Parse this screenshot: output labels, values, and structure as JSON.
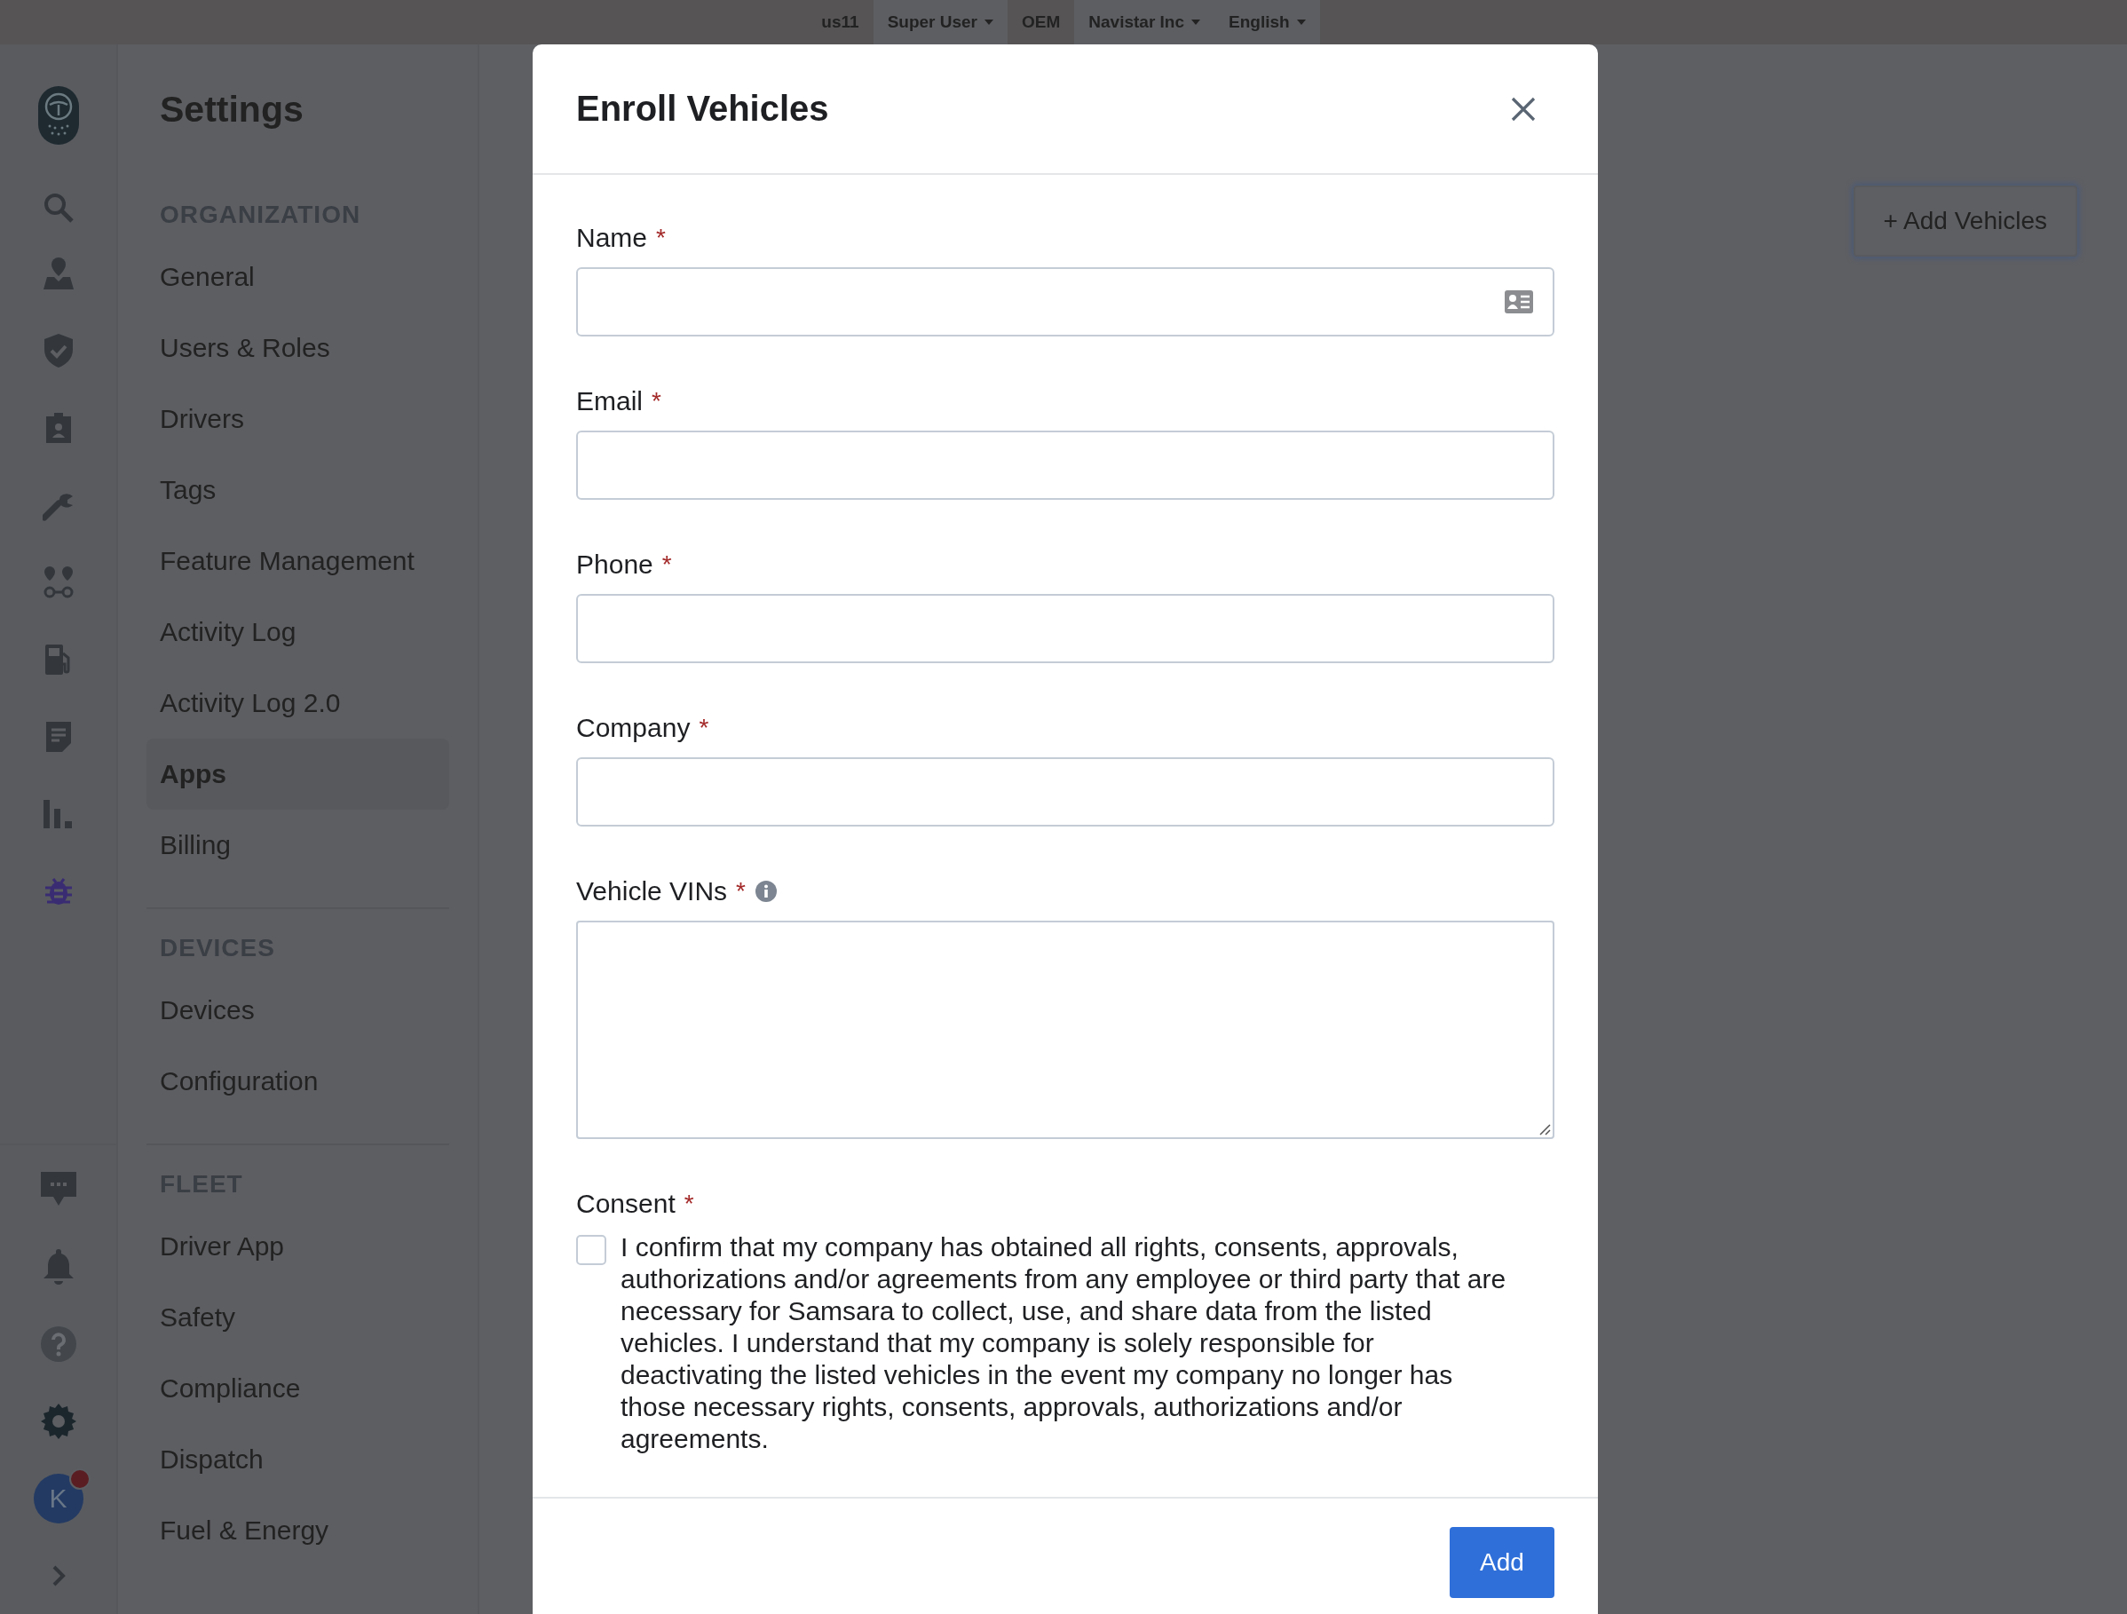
{
  "top_bar": {
    "items": [
      {
        "label": "us11",
        "kind": "plain"
      },
      {
        "label": "Super User",
        "kind": "dropdown"
      },
      {
        "label": "OEM",
        "kind": "plain"
      },
      {
        "label": "Navistar Inc",
        "kind": "dropdown"
      },
      {
        "label": "English",
        "kind": "dropdown"
      }
    ]
  },
  "icon_rail": {
    "avatar": {
      "initial": "K",
      "notification": true
    }
  },
  "settings_sidebar": {
    "title": "Settings",
    "sections": [
      {
        "heading": "ORGANIZATION",
        "items": [
          {
            "label": "General",
            "selected": false
          },
          {
            "label": "Users & Roles",
            "selected": false
          },
          {
            "label": "Drivers",
            "selected": false
          },
          {
            "label": "Tags",
            "selected": false
          },
          {
            "label": "Feature Management",
            "selected": false
          },
          {
            "label": "Activity Log",
            "selected": false
          },
          {
            "label": "Activity Log 2.0",
            "selected": false
          },
          {
            "label": "Apps",
            "selected": true
          },
          {
            "label": "Billing",
            "selected": false
          }
        ]
      },
      {
        "heading": "DEVICES",
        "items": [
          {
            "label": "Devices",
            "selected": false
          },
          {
            "label": "Configuration",
            "selected": false
          }
        ]
      },
      {
        "heading": "FLEET",
        "items": [
          {
            "label": "Driver App",
            "selected": false
          },
          {
            "label": "Safety",
            "selected": false
          },
          {
            "label": "Compliance",
            "selected": false
          },
          {
            "label": "Dispatch",
            "selected": false
          },
          {
            "label": "Fuel & Energy",
            "selected": false
          }
        ]
      }
    ]
  },
  "page": {
    "add_button": "+ Add Vehicles"
  },
  "modal": {
    "title": "Enroll Vehicles",
    "fields": [
      {
        "label": "Name",
        "required_mark": "*",
        "kind": "contact_input"
      },
      {
        "label": "Email",
        "required_mark": "*",
        "kind": "input"
      },
      {
        "label": "Phone",
        "required_mark": "*",
        "kind": "input"
      },
      {
        "label": "Company",
        "required_mark": "*",
        "kind": "input"
      },
      {
        "label": "Vehicle VINs",
        "required_mark": "*",
        "kind": "textarea",
        "info": true
      }
    ],
    "consent": {
      "label": "Consent",
      "required_mark": "*",
      "checked": false,
      "text": "I confirm that my company has obtained all rights, consents, approvals, authorizations and/or agreements from any employee or third party that are necessary for Samsara to collect, use, and share data from the listed vehicles. I understand that my company is solely responsible for deactivating the listed vehicles in the event my company no longer has those necessary rights, consents, approvals, authorizations and/or agreements."
    },
    "submit": "Add"
  }
}
